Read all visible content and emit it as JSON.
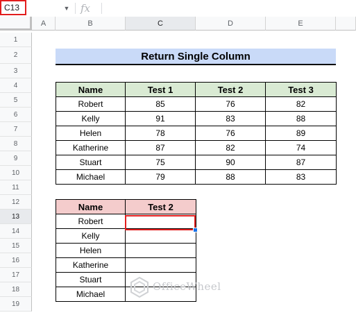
{
  "formula_bar": {
    "name_box": "C13",
    "fx_label": "fx",
    "formula": ""
  },
  "columns": [
    "A",
    "B",
    "C",
    "D",
    "E"
  ],
  "selected_column": "C",
  "rows": [
    "1",
    "2",
    "3",
    "4",
    "5",
    "6",
    "7",
    "8",
    "9",
    "10",
    "11",
    "12",
    "13",
    "14",
    "15",
    "16",
    "17",
    "18",
    "19"
  ],
  "selected_row": "13",
  "title": "Return Single Column",
  "table1": {
    "headers": [
      "Name",
      "Test 1",
      "Test 2",
      "Test 3"
    ],
    "rows": [
      [
        "Robert",
        "85",
        "76",
        "82"
      ],
      [
        "Kelly",
        "91",
        "83",
        "88"
      ],
      [
        "Helen",
        "78",
        "76",
        "89"
      ],
      [
        "Katherine",
        "87",
        "82",
        "74"
      ],
      [
        "Stuart",
        "75",
        "90",
        "87"
      ],
      [
        "Michael",
        "79",
        "88",
        "83"
      ]
    ]
  },
  "table2": {
    "headers": [
      "Name",
      "Test 2"
    ],
    "rows": [
      [
        "Robert",
        ""
      ],
      [
        "Kelly",
        ""
      ],
      [
        "Helen",
        ""
      ],
      [
        "Katherine",
        ""
      ],
      [
        "Stuart",
        ""
      ],
      [
        "Michael",
        ""
      ]
    ]
  },
  "watermark": "OfficeWheel",
  "colors": {
    "title_fill": "#c9daf8",
    "table1_header_fill": "#d9ead3",
    "table2_header_fill": "#f4cccc",
    "highlight_border": "#e21d1d"
  }
}
